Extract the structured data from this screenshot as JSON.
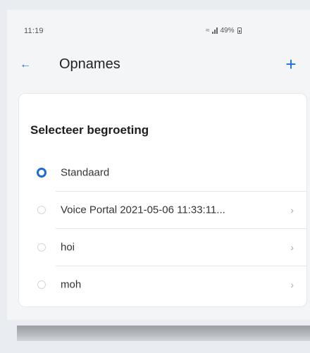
{
  "status_bar": {
    "time": "11:19",
    "battery_text": "49%"
  },
  "app_bar": {
    "title": "Opnames",
    "back_icon": "arrow-left-icon",
    "add_icon": "plus-icon",
    "accent_color": "#1c6ed6"
  },
  "card": {
    "title": "Selecteer begroeting",
    "options": [
      {
        "label": "Standaard",
        "selected": true,
        "has_chevron": false
      },
      {
        "label": "Voice Portal 2021-05-06 11:33:11...",
        "selected": false,
        "has_chevron": true
      },
      {
        "label": "hoi",
        "selected": false,
        "has_chevron": true
      },
      {
        "label": "moh",
        "selected": false,
        "has_chevron": true
      }
    ]
  }
}
